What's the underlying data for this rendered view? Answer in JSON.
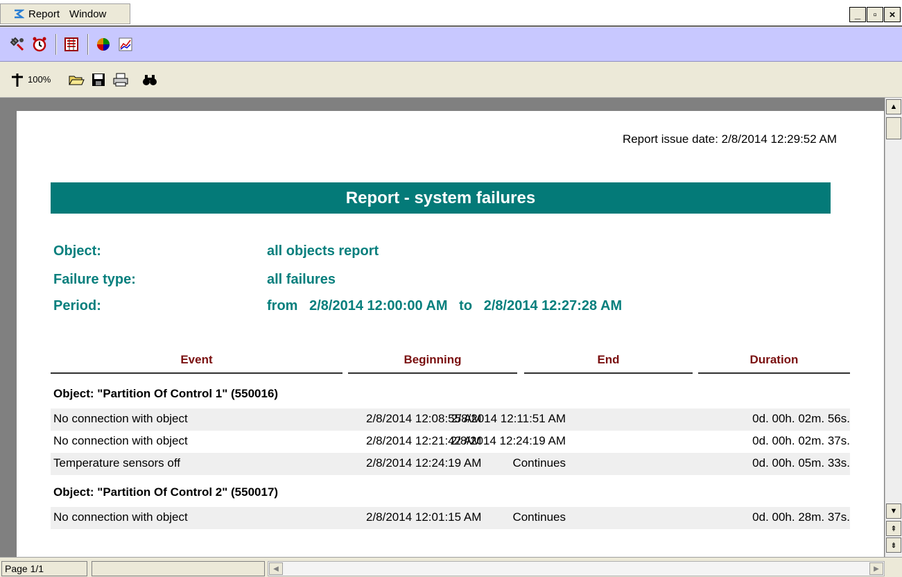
{
  "menubar": {
    "items": [
      "Report",
      "Window"
    ],
    "window_buttons": [
      "_",
      "▫",
      "×"
    ]
  },
  "toolbar1": {
    "icons": [
      "tools-icon",
      "alarm-clock-icon",
      "film-report-icon",
      "pie-chart-icon",
      "line-chart-icon"
    ]
  },
  "toolbar2": {
    "zoom": "100%",
    "icons": [
      "zoom-icon",
      "open-folder-icon",
      "save-icon",
      "print-icon",
      "find-icon"
    ]
  },
  "report": {
    "issue_date": "Report issue date: 2/8/2014 12:29:52 AM",
    "title": "Report - system failures",
    "object_label": "Object:",
    "object_value": "all objects report",
    "failure_label": "Failure type:",
    "failure_value": "all failures",
    "period_label": "Period:",
    "period_value": "from   2/8/2014 12:00:00 AM   to   2/8/2014 12:27:28 AM",
    "columns": [
      "Event",
      "Beginning",
      "End",
      "Duration"
    ],
    "groups": [
      {
        "title": "Object: \"Partition Of Control 1\" (550016)",
        "rows": [
          {
            "event": "No connection with object",
            "begin": "2/8/2014 12:08:55 AM",
            "end": "2/8/2014 12:11:51 AM",
            "duration": "0d. 00h. 02m. 56s."
          },
          {
            "event": "No connection with object",
            "begin": "2/8/2014 12:21:42 AM",
            "end": "2/8/2014 12:24:19 AM",
            "duration": "0d. 00h. 02m. 37s."
          },
          {
            "event": "Temperature sensors off",
            "begin": "2/8/2014 12:24:19 AM",
            "end": "Continues",
            "duration": "0d. 00h. 05m. 33s."
          }
        ]
      },
      {
        "title": "Object: \"Partition Of Control 2\" (550017)",
        "rows": [
          {
            "event": "No connection with object",
            "begin": "2/8/2014 12:01:15 AM",
            "end": "Continues",
            "duration": "0d. 00h. 28m. 37s."
          }
        ]
      }
    ]
  },
  "status": {
    "page": "Page 1/1"
  },
  "colors": {
    "accent_teal": "#047a78",
    "info_teal": "#077f7d",
    "header_red": "#7a1010",
    "toolbar_lavender": "#c8c8ff"
  }
}
